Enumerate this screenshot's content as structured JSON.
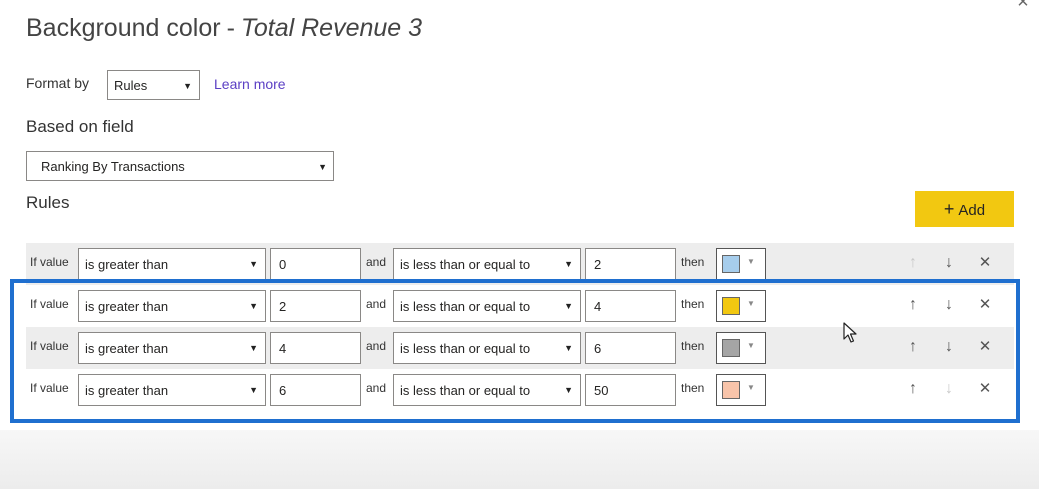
{
  "dialog": {
    "title_prefix": "Background color",
    "title_sep": "-",
    "title_field": "Total Revenue 3"
  },
  "format_by": {
    "label": "Format by",
    "selected": "Rules",
    "learn_more": "Learn more"
  },
  "based_on": {
    "label": "Based on field",
    "selected": "Ranking By Transactions"
  },
  "rules": {
    "label": "Rules",
    "add_label": "Add",
    "items": [
      {
        "if_label": "If value",
        "op1": "is greater than",
        "val1": "0",
        "and_label": "and",
        "op2": "is less than or equal to",
        "val2": "2",
        "then_label": "then",
        "color": "#a6cdec",
        "up_enabled": false,
        "down_enabled": true
      },
      {
        "if_label": "If value",
        "op1": "is greater than",
        "val1": "2",
        "and_label": "and",
        "op2": "is less than or equal to",
        "val2": "4",
        "then_label": "then",
        "color": "#f2c811",
        "up_enabled": true,
        "down_enabled": true
      },
      {
        "if_label": "If value",
        "op1": "is greater than",
        "val1": "4",
        "and_label": "and",
        "op2": "is less than or equal to",
        "val2": "6",
        "then_label": "then",
        "color": "#a5a5a5",
        "up_enabled": true,
        "down_enabled": true
      },
      {
        "if_label": "If value",
        "op1": "is greater than",
        "val1": "6",
        "and_label": "and",
        "op2": "is less than or equal to",
        "val2": "50",
        "then_label": "then",
        "color": "#f8c4aa",
        "up_enabled": true,
        "down_enabled": false
      }
    ]
  },
  "colors": {
    "accent_button": "#f2c811",
    "highlight_border": "#1f6fcf",
    "link": "#5b3fc4"
  },
  "icons": {
    "close": "close-icon",
    "add": "plus-icon",
    "up": "arrow-up-icon",
    "down": "arrow-down-icon",
    "delete": "close-icon",
    "caret": "chevron-down-icon",
    "cursor": "mouse-pointer-icon"
  }
}
